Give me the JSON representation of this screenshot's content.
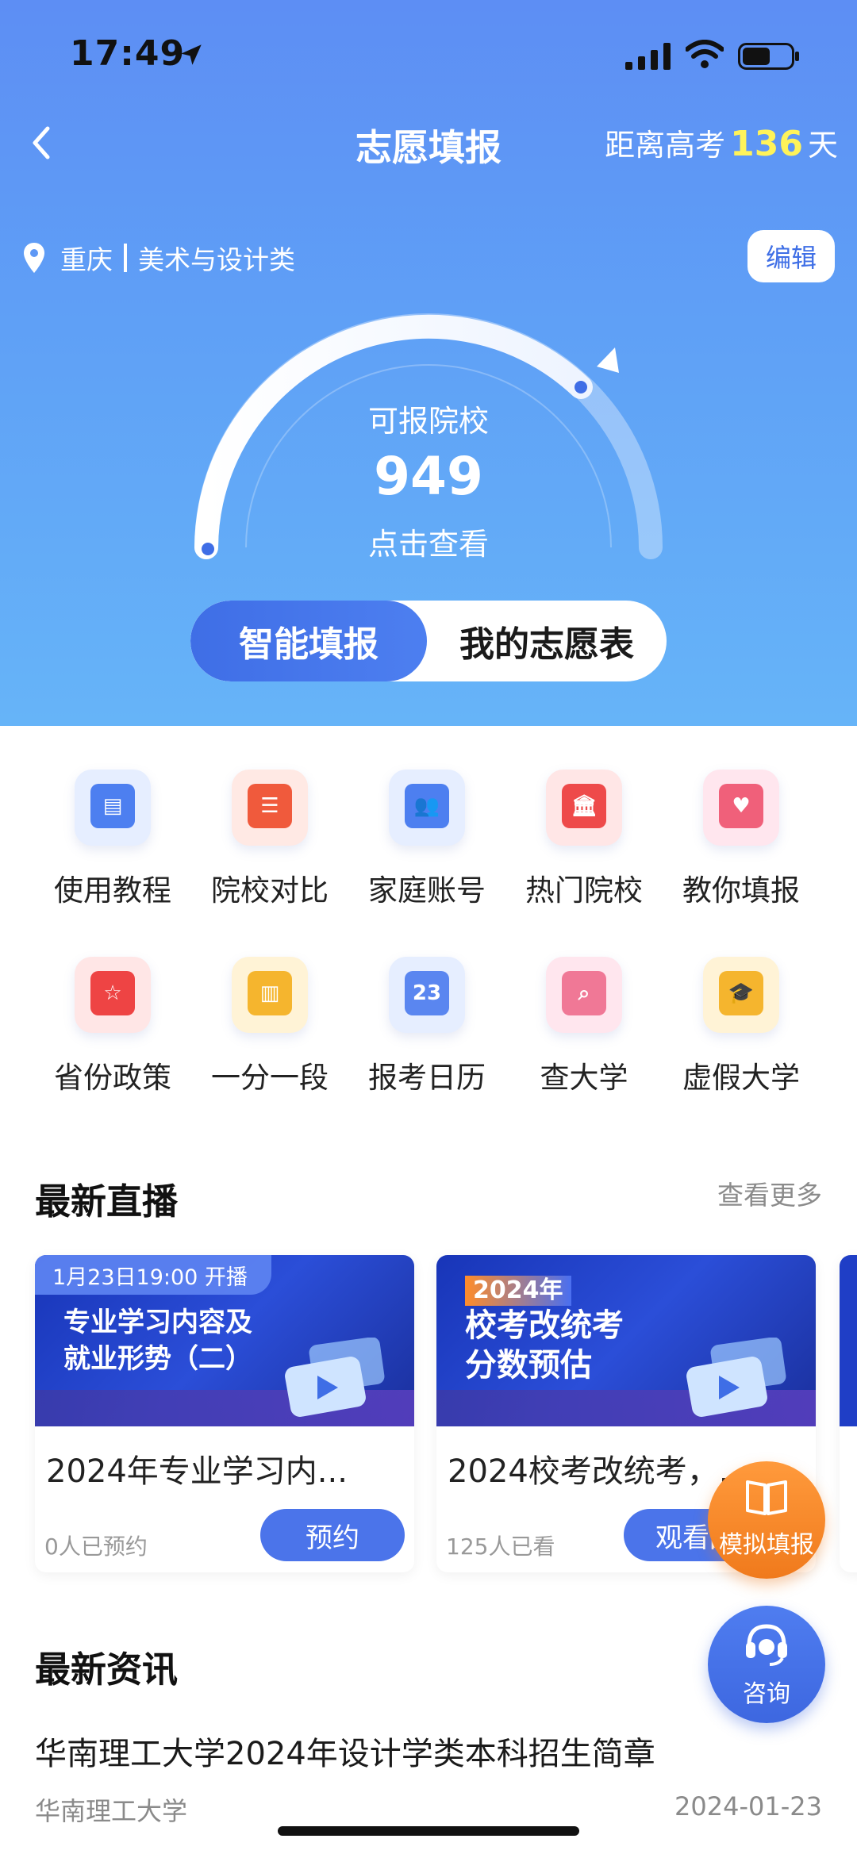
{
  "status_bar": {
    "time": "17:49"
  },
  "header": {
    "title": "志愿填报",
    "countdown_prefix": "距离高考",
    "countdown_days": "136",
    "countdown_suffix": "天"
  },
  "profile": {
    "province": "重庆",
    "category": "美术与设计类",
    "edit_label": "编辑"
  },
  "gauge": {
    "title": "可报院校",
    "value": "949",
    "action": "点击查看"
  },
  "mode_toggle": {
    "smart": "智能填报",
    "mine": "我的志愿表"
  },
  "tools": [
    {
      "label": "使用教程",
      "icon": "book-icon",
      "bg": "#e6eeff",
      "fg": "#4d7ff0",
      "glyph": "▤"
    },
    {
      "label": "院校对比",
      "icon": "compare-icon",
      "bg": "#ffe9e4",
      "fg": "#f05a3c",
      "glyph": "☰"
    },
    {
      "label": "家庭账号",
      "icon": "family-icon",
      "bg": "#e6eeff",
      "fg": "#4d7ff0",
      "glyph": "👥"
    },
    {
      "label": "热门院校",
      "icon": "university-icon",
      "bg": "#ffe6e6",
      "fg": "#ee4a4a",
      "glyph": "🏛"
    },
    {
      "label": "教你填报",
      "icon": "heart-card-icon",
      "bg": "#ffe6ee",
      "fg": "#f0607a",
      "glyph": "♥"
    },
    {
      "label": "省份政策",
      "icon": "policy-icon",
      "bg": "#ffe6e6",
      "fg": "#ee4444",
      "glyph": "☆"
    },
    {
      "label": "一分一段",
      "icon": "score-map-icon",
      "bg": "#fff3d6",
      "fg": "#f5b52e",
      "glyph": "▥"
    },
    {
      "label": "报考日历",
      "icon": "calendar-icon",
      "bg": "#e6eeff",
      "fg": "#5a86f0",
      "glyph": "23"
    },
    {
      "label": "查大学",
      "icon": "search-university-icon",
      "bg": "#ffe6ee",
      "fg": "#f07896",
      "glyph": "⌕"
    },
    {
      "label": "虚假大学",
      "icon": "graduation-cap-icon",
      "bg": "#fff3d6",
      "fg": "#f5b52e",
      "glyph": "🎓"
    }
  ],
  "live": {
    "section_title": "最新直播",
    "see_more": "查看更多",
    "cards": [
      {
        "tag": "1月23日19:00 开播",
        "cover_line1": "专业学习内容及",
        "cover_line2": "就业形势（二）",
        "title": "2024年专业学习内...",
        "meta": "0人已预约",
        "button": "预约"
      },
      {
        "year": "2024年",
        "cover_line1": "校考改统考",
        "cover_line2": "分数预估",
        "title": "2024校考改统考，...",
        "meta": "125人已看",
        "button": "观看回"
      }
    ]
  },
  "fab": {
    "simulate": "模拟填报",
    "consult": "咨询"
  },
  "news": {
    "section_title": "最新资讯",
    "items": [
      {
        "title": "华南理工大学2024年设计学类本科招生简章",
        "source": "华南理工大学",
        "date": "2024-01-23"
      }
    ]
  }
}
